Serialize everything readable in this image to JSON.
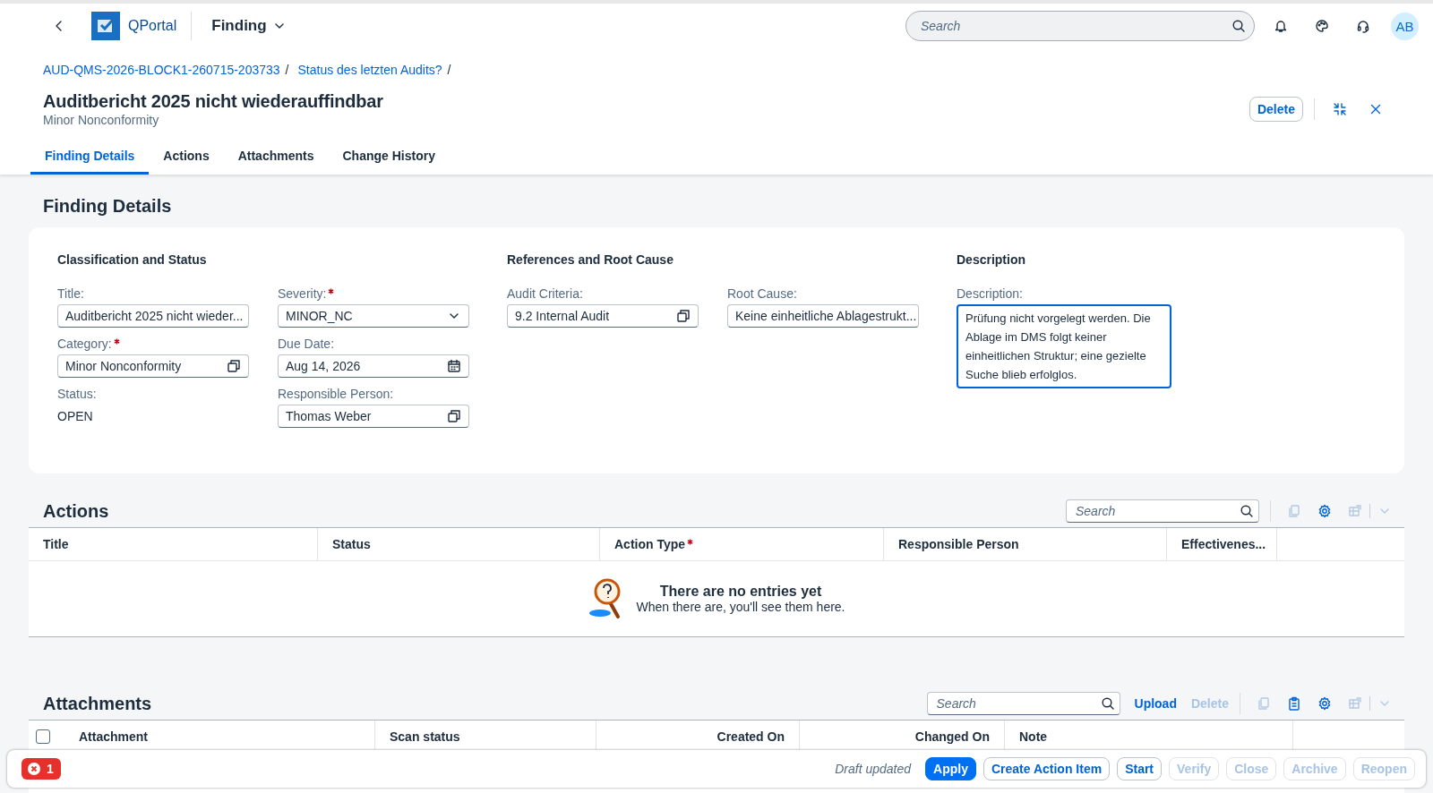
{
  "shell": {
    "logo": "QPortal",
    "app_title": "Finding",
    "search": {
      "placeholder": "Search"
    },
    "avatar": "AB"
  },
  "breadcrumbs": [
    {
      "label": "AUD-QMS-2026-BLOCK1-260715-203733",
      "separator": "/"
    },
    {
      "label": "Status des letzten Audits?",
      "separator": "/"
    }
  ],
  "object": {
    "title": "Auditbericht 2025 nicht wiederauffindbar",
    "subtitle": "Minor Nonconformity",
    "actions": [
      {
        "label": "Delete"
      }
    ]
  },
  "tabs": [
    {
      "label": "Finding Details",
      "selected": true
    },
    {
      "label": "Actions",
      "selected": false
    },
    {
      "label": "Attachments",
      "selected": false
    },
    {
      "label": "Change History",
      "selected": false
    }
  ],
  "details": {
    "title": "Finding Details",
    "groups": [
      {
        "title": "Classification and Status",
        "columns": [
          [
            {
              "label": "Title:",
              "kind": "text",
              "value": "Auditbericht 2025 nicht wieder...",
              "required": false
            },
            {
              "label": "Category:",
              "kind": "valuehelp",
              "value": "Minor Nonconformity",
              "required": true
            },
            {
              "label": "Status:",
              "kind": "readonly",
              "value": "OPEN",
              "required": false
            }
          ],
          [
            {
              "label": "Severity:",
              "kind": "select",
              "value": "MINOR_NC",
              "required": true
            },
            {
              "label": "Due Date:",
              "kind": "date",
              "value": "Aug 14, 2026",
              "required": false
            },
            {
              "label": "Responsible Person:",
              "kind": "valuehelp",
              "value": "Thomas Weber",
              "required": false
            }
          ]
        ]
      },
      {
        "title": "References and Root Cause",
        "columns": [
          [
            {
              "label": "Audit Criteria:",
              "kind": "valuehelp",
              "value": "9.2 Internal Audit",
              "required": false
            }
          ],
          [
            {
              "label": "Root Cause:",
              "kind": "text",
              "value": "Keine einheitliche Ablagestrukt...",
              "required": false
            }
          ]
        ]
      },
      {
        "title": "Description",
        "columns": [
          [
            {
              "label": "Description:",
              "kind": "textarea",
              "value": "Prüfung nicht vorgelegt werden. Die Ablage im DMS folgt keiner einheitlichen Struktur; eine gezielte Suche blieb erfolglos.",
              "required": false
            }
          ]
        ]
      }
    ]
  },
  "actions_table": {
    "title": "Actions",
    "search": {
      "placeholder": "Search"
    },
    "toolbar": [
      {
        "kind": "copy",
        "disabled": true
      },
      {
        "kind": "settings",
        "disabled": false
      },
      {
        "kind": "export",
        "disabled": true
      }
    ],
    "columns": [
      {
        "label": "Title",
        "required": false
      },
      {
        "label": "Status",
        "required": false
      },
      {
        "label": "Action Type",
        "required": true
      },
      {
        "label": "Responsible Person",
        "required": false
      },
      {
        "label": "Effectivenes...",
        "required": false
      }
    ],
    "empty": {
      "title": "There are no entries yet",
      "text": "When there are, you'll see them here."
    }
  },
  "attachments_table": {
    "title": "Attachments",
    "search": {
      "placeholder": "Search"
    },
    "buttons": [
      {
        "label": "Upload",
        "disabled": false
      },
      {
        "label": "Delete",
        "disabled": true
      }
    ],
    "toolbar": [
      {
        "kind": "copy",
        "disabled": true
      },
      {
        "kind": "paste",
        "disabled": false
      },
      {
        "kind": "settings",
        "disabled": false
      },
      {
        "kind": "export",
        "disabled": true
      }
    ],
    "select_all": {
      "checked": false
    },
    "columns": [
      {
        "label": "Attachment",
        "kind": "text"
      },
      {
        "label": "Scan status",
        "kind": "text"
      },
      {
        "label": "Created On",
        "kind": "date"
      },
      {
        "label": "Changed On",
        "kind": "date"
      },
      {
        "label": "Note",
        "kind": "text"
      }
    ]
  },
  "footer": {
    "errors": "1",
    "status": "Draft updated",
    "buttons": [
      {
        "label": "Apply",
        "kind": "emphasized",
        "disabled": false
      },
      {
        "label": "Create Action Item",
        "kind": "default",
        "disabled": false
      },
      {
        "label": "Start",
        "kind": "default",
        "disabled": false
      },
      {
        "label": "Verify",
        "kind": "default",
        "disabled": true
      },
      {
        "label": "Close",
        "kind": "default",
        "disabled": true
      },
      {
        "label": "Archive",
        "kind": "default",
        "disabled": true
      },
      {
        "label": "Reopen",
        "kind": "default",
        "disabled": true
      }
    ]
  }
}
